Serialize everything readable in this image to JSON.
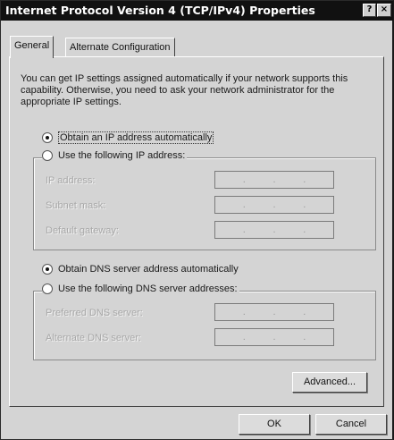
{
  "window": {
    "title": "Internet Protocol Version 4 (TCP/IPv4) Properties",
    "help_label": "?",
    "close_label": "×"
  },
  "tabs": [
    {
      "label": "General",
      "active": true
    },
    {
      "label": "Alternate Configuration",
      "active": false
    }
  ],
  "intro_text": "You can get IP settings assigned automatically if your network supports this capability. Otherwise, you need to ask your network administrator for the appropriate IP settings.",
  "ip_section": {
    "auto_label": "Obtain an IP address automatically",
    "auto_selected": true,
    "manual_label": "Use the following IP address:",
    "manual_selected": false,
    "fields": [
      {
        "label": "IP address:",
        "value": ". . ."
      },
      {
        "label": "Subnet mask:",
        "value": ". . ."
      },
      {
        "label": "Default gateway:",
        "value": ". . ."
      }
    ]
  },
  "dns_section": {
    "auto_label": "Obtain DNS server address automatically",
    "auto_selected": true,
    "manual_label": "Use the following DNS server addresses:",
    "manual_selected": false,
    "fields": [
      {
        "label": "Preferred DNS server:",
        "value": ". . ."
      },
      {
        "label": "Alternate DNS server:",
        "value": ". . ."
      }
    ]
  },
  "buttons": {
    "advanced": "Advanced...",
    "ok": "OK",
    "cancel": "Cancel"
  },
  "dot": "."
}
